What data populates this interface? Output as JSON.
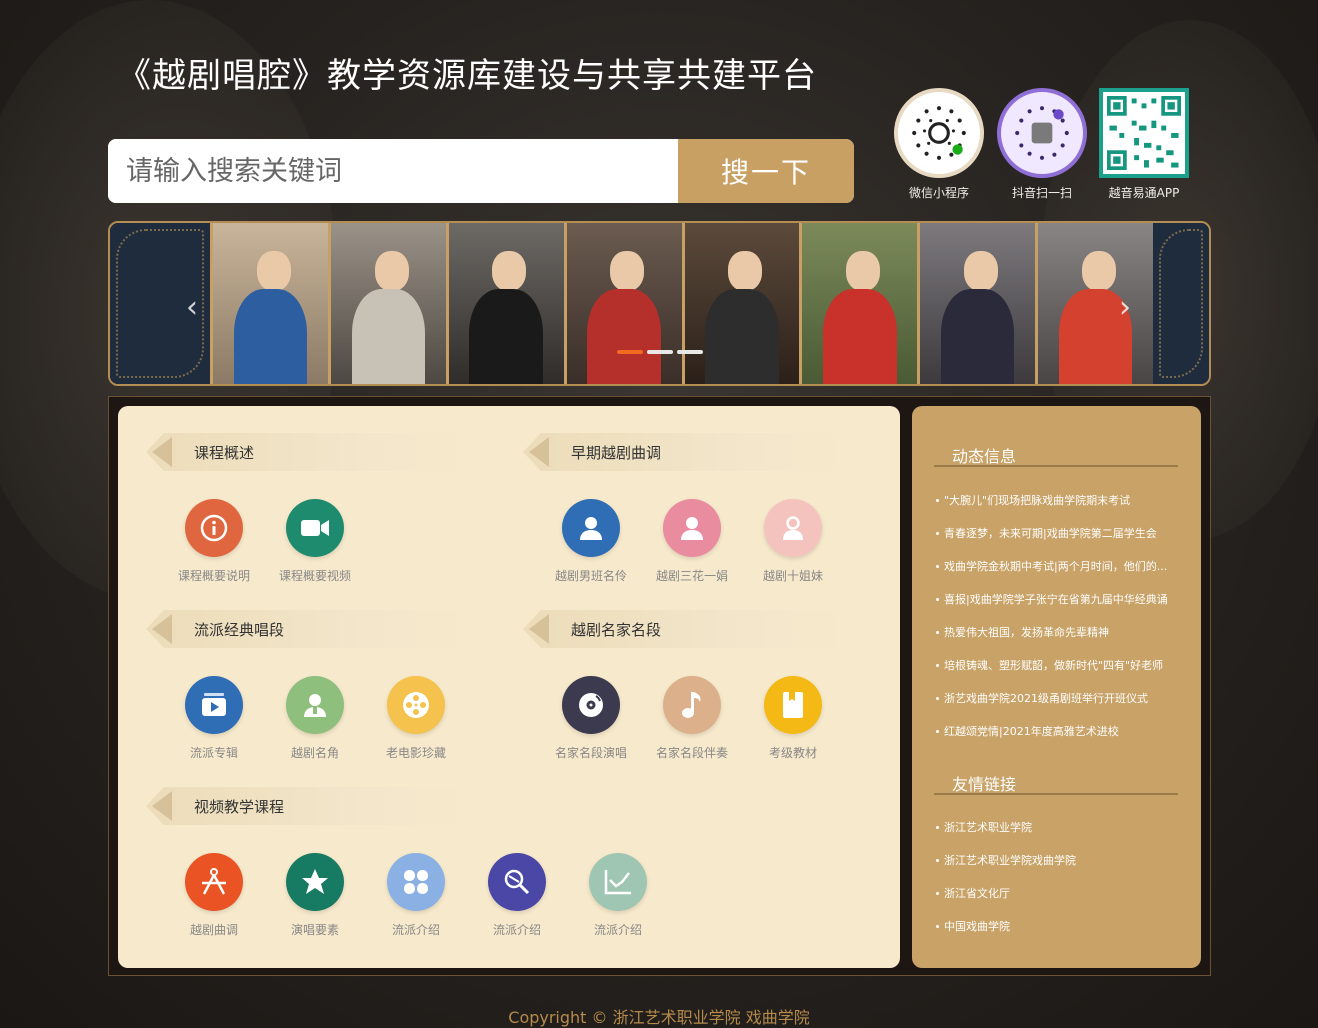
{
  "site": {
    "title": "《越剧唱腔》教学资源库建设与共享共建平台"
  },
  "search": {
    "placeholder": "请输入搜索关键词",
    "button_label": "搜一下"
  },
  "qrcodes": [
    {
      "label": "微信小程序"
    },
    {
      "label": "抖音扫一扫"
    },
    {
      "label": "越音易通APP"
    }
  ],
  "sections": {
    "course_overview": {
      "title": "课程概述",
      "items": [
        {
          "label": "课程概要说明",
          "icon": "info-icon",
          "color": "#e0663f"
        },
        {
          "label": "课程概要视频",
          "icon": "video-camera-icon",
          "color": "#1e8b6e"
        }
      ]
    },
    "early_tunes": {
      "title": "早期越剧曲调",
      "items": [
        {
          "label": "越剧男班名伶",
          "icon": "person-icon",
          "color": "#2f6db5"
        },
        {
          "label": "越剧三花一娟",
          "icon": "person-icon",
          "color": "#e98ca0"
        },
        {
          "label": "越剧十姐妹",
          "icon": "person-lock-icon",
          "color": "#f5c3bd"
        }
      ]
    },
    "school_classics": {
      "title": "流派经典唱段",
      "items": [
        {
          "label": "流派专辑",
          "icon": "album-play-icon",
          "color": "#2f6db5"
        },
        {
          "label": "越剧名角",
          "icon": "avatar-icon",
          "color": "#8fbf7d"
        },
        {
          "label": "老电影珍藏",
          "icon": "film-reel-icon",
          "color": "#f4c24d"
        }
      ]
    },
    "master_pieces": {
      "title": "越剧名家名段",
      "items": [
        {
          "label": "名家名段演唱",
          "icon": "disc-icon",
          "color": "#3b3a4e"
        },
        {
          "label": "名家名段伴奏",
          "icon": "music-note-icon",
          "color": "#dcb08b"
        },
        {
          "label": "考级教材",
          "icon": "book-icon",
          "color": "#f5b915"
        }
      ]
    },
    "video_courses": {
      "title": "视频教学课程",
      "items": [
        {
          "label": "越剧曲调",
          "icon": "compass-icon",
          "color": "#ea5324"
        },
        {
          "label": "演唱要素",
          "icon": "star-icon",
          "color": "#177a62"
        },
        {
          "label": "流派介绍",
          "icon": "grid-icon",
          "color": "#8ab0e4"
        },
        {
          "label": "流派介绍",
          "icon": "search-tag-icon",
          "color": "#4b47a6"
        },
        {
          "label": "流派介绍",
          "icon": "chart-line-icon",
          "color": "#9fc6b3"
        }
      ]
    }
  },
  "news": {
    "title": "动态信息",
    "items": [
      "\"大腕儿\"们现场把脉戏曲学院期末考试",
      "青春逐梦，未来可期|戏曲学院第二届学生会",
      "戏曲学院金秋期中考试|两个月时间，他们的...",
      "喜报|戏曲学院学子张宁在省第九届中华经典诵",
      "热爱伟大祖国，发扬革命先辈精神",
      "培根铸魂、塑形赋韶，做新时代\"四有\"好老师",
      "浙艺戏曲学院2021级甬剧班举行开班仪式",
      "红越颂党情|2021年度高雅艺术进校"
    ]
  },
  "links": {
    "title": "友情链接",
    "items": [
      "浙江艺术职业学院",
      "浙江艺术职业学院戏曲学院",
      "浙江省文化厅",
      "中国戏曲学院"
    ]
  },
  "banner": {
    "slides": 3,
    "active": 1
  },
  "footer": {
    "text": "Copyright © 浙江艺术职业学院 戏曲学院"
  },
  "colors": {
    "accent": "#c9a063",
    "panel": "#f7e9cb",
    "sidebar": "#c8a266",
    "dot_active": "#f16a1e"
  }
}
